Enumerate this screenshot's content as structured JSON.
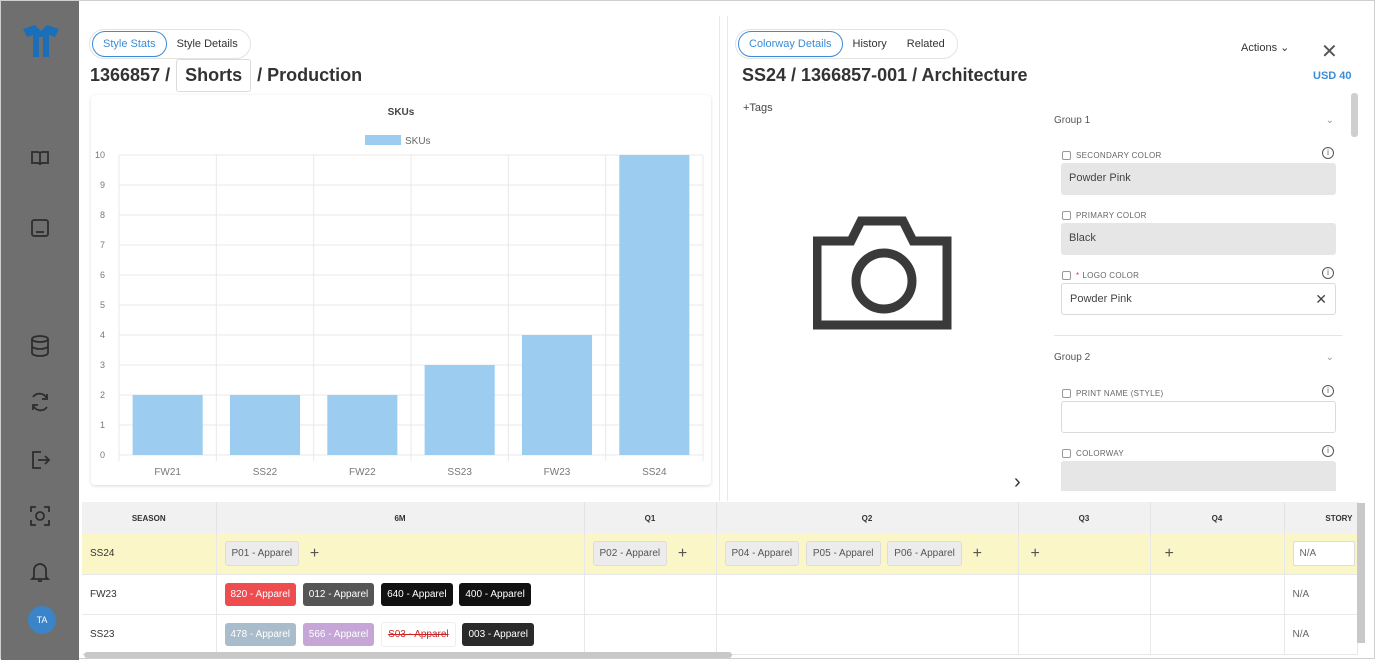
{
  "sidebar": {
    "icons": [
      "logo-icon",
      "book-icon",
      "inbox-icon",
      "database-icon",
      "sync-icon",
      "export-icon",
      "scan-icon",
      "bell-icon"
    ],
    "avatar_initials": "TA",
    "color": "#6f6f6f"
  },
  "left": {
    "tabs": [
      "Style Stats",
      "Style Details"
    ],
    "title_prefix": "1366857 /",
    "title_boxed": "Shorts",
    "title_suffix": "/ Production"
  },
  "chart_data": {
    "type": "bar",
    "title": "SKUs",
    "legend": [
      "SKUs"
    ],
    "categories": [
      "FW21",
      "SS22",
      "FW22",
      "SS23",
      "FW23",
      "SS24"
    ],
    "series": [
      {
        "name": "SKUs",
        "values": [
          2,
          2,
          2,
          3,
          4,
          10
        ]
      }
    ],
    "ylim": [
      0,
      10
    ],
    "yticks": [
      0,
      1,
      2,
      3,
      4,
      5,
      6,
      7,
      8,
      9,
      10
    ],
    "bar_color": "#9ccdf0",
    "grid": true,
    "legend_position": "top-center"
  },
  "right": {
    "tabs": [
      "Colorway Details",
      "History",
      "Related"
    ],
    "title": "SS24 / 1366857-001 / Architecture",
    "actions_label": "Actions",
    "close_label": "✕",
    "currency": "USD 40",
    "tags_label": "+Tags",
    "groups": [
      {
        "name": "Group 1"
      },
      {
        "name": "Group 2"
      }
    ],
    "fields": {
      "secondary_color": {
        "label": "SECONDARY COLOR",
        "value": "Powder Pink"
      },
      "primary_color": {
        "label": "PRIMARY COLOR",
        "value": "Black"
      },
      "logo_color": {
        "label": "LOGO COLOR",
        "value": "Powder Pink",
        "required_mark": "*"
      },
      "print_name": {
        "label": "PRINT NAME (STYLE)",
        "value": ""
      },
      "colorway": {
        "label": "COLORWAY",
        "value": ""
      }
    }
  },
  "table": {
    "headers": [
      "SEASON",
      "6M",
      "Q1",
      "Q2",
      "Q3",
      "Q4",
      "STORY"
    ],
    "rows": [
      {
        "season": "SS24",
        "m6": [
          "P01 - Apparel"
        ],
        "q1": [
          "P02 - Apparel"
        ],
        "q2": [
          "P04 - Apparel",
          "P05 - Apparel",
          "P06 - Apparel"
        ],
        "story": "N/A"
      },
      {
        "season": "FW23",
        "m6": [
          "820 - Apparel",
          "012 - Apparel",
          "640 - Apparel",
          "400 - Apparel"
        ],
        "story": "N/A"
      },
      {
        "season": "SS23",
        "m6": [
          "478 - Apparel",
          "566 - Apparel",
          "S03 - Apparel",
          "003 - Apparel"
        ],
        "story": "N/A"
      }
    ],
    "chip_colors": {
      "820": "#ef4c50",
      "012": "#555555",
      "640": "#111111",
      "400": "#111111",
      "478": "#a9bccb",
      "566": "#c5a6d6",
      "003": "#2a2a2a"
    },
    "highlight_color": "#fbf6c7"
  }
}
